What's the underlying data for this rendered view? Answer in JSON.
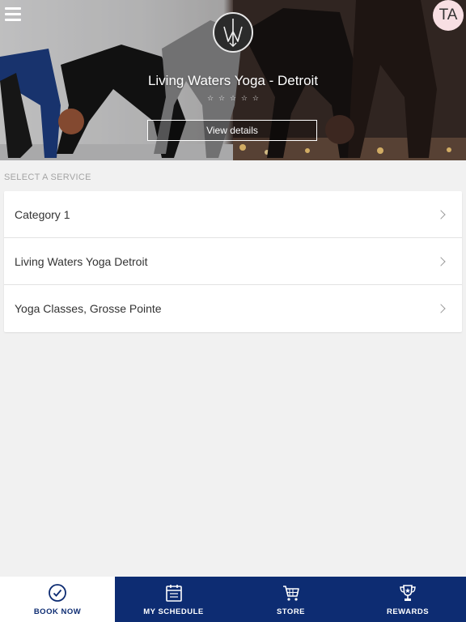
{
  "header": {
    "studio_name": "Living Waters Yoga - Detroit",
    "rating_stars": 0,
    "rating_max": 5,
    "view_details_label": "View details",
    "avatar_initials": "TA",
    "logo_icon": "yoga-logo-icon"
  },
  "services": {
    "section_label": "SELECT A SERVICE",
    "items": [
      {
        "label": "Category 1"
      },
      {
        "label": "Living Waters Yoga Detroit"
      },
      {
        "label": "Yoga Classes, Grosse Pointe"
      }
    ]
  },
  "tabbar": {
    "active_index": 0,
    "tabs": [
      {
        "label": "BOOK NOW",
        "icon": "check-circle-icon"
      },
      {
        "label": "MY SCHEDULE",
        "icon": "calendar-icon"
      },
      {
        "label": "STORE",
        "icon": "cart-icon"
      },
      {
        "label": "REWARDS",
        "icon": "trophy-icon"
      }
    ]
  },
  "colors": {
    "nav_background": "#0d2c72",
    "active_tab_background": "#ffffff",
    "page_background": "#f1f1f1",
    "avatar_background": "#f8dfe3"
  }
}
